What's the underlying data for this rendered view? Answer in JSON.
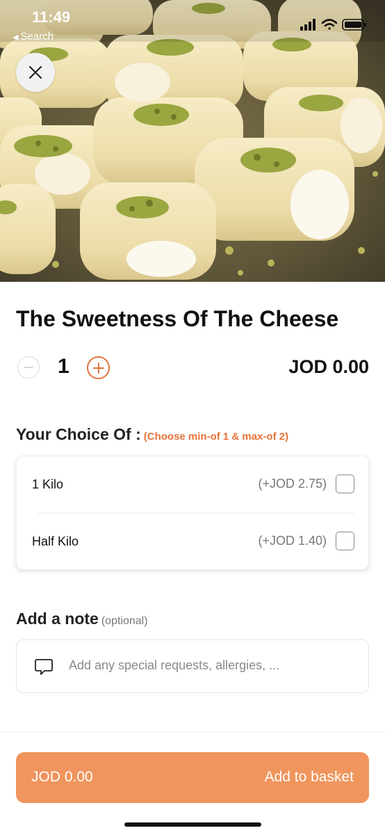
{
  "status_bar": {
    "time": "11:49",
    "back_label": "Search",
    "icons": [
      "signal-icon",
      "wifi-icon",
      "battery-icon"
    ]
  },
  "hero": {
    "close_icon": "close-icon"
  },
  "product": {
    "title": "The Sweetness Of The Cheese",
    "quantity": "1",
    "price": "JOD 0.00"
  },
  "choices": {
    "title": "Your Choice Of :",
    "hint": "(Choose min-of 1 & max-of 2)",
    "options": [
      {
        "label": "1 Kilo",
        "price": "(+JOD 2.75)",
        "checked": false
      },
      {
        "label": "Half Kilo",
        "price": "(+JOD 1.40)",
        "checked": false
      }
    ]
  },
  "note": {
    "title": "Add a note",
    "optional": "(optional)",
    "placeholder": "Add any special requests, allergies, ..."
  },
  "footer": {
    "price": "JOD 0.00",
    "add_label": "Add to basket"
  },
  "colors": {
    "accent": "#e8733a",
    "button": "#f0955d",
    "hero_tray": "#6b6142",
    "dessert": "#efe1b3",
    "pistachio": "#9aa640"
  }
}
